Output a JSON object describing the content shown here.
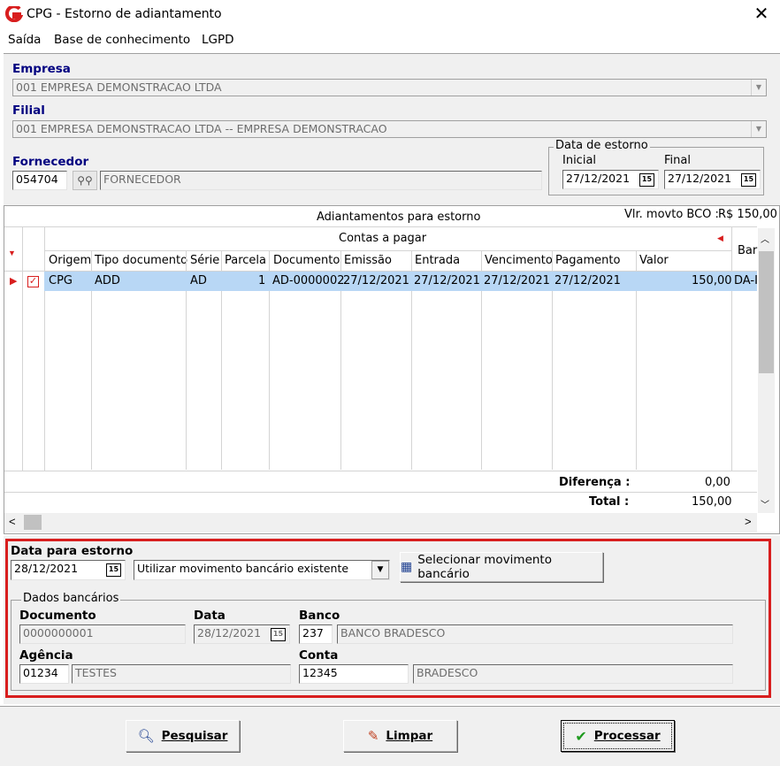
{
  "window": {
    "title": "CPG - Estorno de adiantamento",
    "close": "✕"
  },
  "menu": [
    "Saída",
    "Base de conhecimento",
    "LGPD"
  ],
  "empresa": {
    "label": "Empresa",
    "value": "001 EMPRESA DEMONSTRACAO LTDA"
  },
  "filial": {
    "label": "Filial",
    "value": "001 EMPRESA DEMONSTRACAO LTDA -- EMPRESA DEMONSTRACAO"
  },
  "fornecedor": {
    "label": "Fornecedor",
    "code": "054704",
    "name": "FORNECEDOR"
  },
  "data_estorno": {
    "group": "Data de estorno",
    "inicial_label": "Inicial",
    "inicial": "27/12/2021",
    "final_label": "Final",
    "final": "27/12/2021"
  },
  "grid": {
    "title": "Adiantamentos para estorno",
    "vlr_label": "Vlr. movto BCO :",
    "vlr_value": "R$ 150,00",
    "group_header": "Contas a pagar",
    "extra_header": "Bar",
    "columns": [
      "Origem",
      "Tipo documento",
      "Série",
      "Parcela",
      "Documento",
      "Emissão",
      "Entrada",
      "Vencimento",
      "Pagamento",
      "Valor"
    ],
    "row": {
      "origem": "CPG",
      "tipo": "ADD",
      "serie": "AD",
      "parcela": "1",
      "documento": "AD-0000002",
      "emissao": "27/12/2021",
      "entrada": "27/12/2021",
      "vencimento": "27/12/2021",
      "pagamento": "27/12/2021",
      "valor": "150,00",
      "banco": "DA-I"
    },
    "diferenca_label": "Diferença :",
    "diferenca_value": "0,00",
    "total_label": "Total :",
    "total_value": "150,00"
  },
  "estorno": {
    "label": "Data para estorno",
    "date": "28/12/2021",
    "option": "Utilizar movimento bancário existente",
    "select_button": "Selecionar movimento bancário"
  },
  "dados": {
    "group": "Dados bancários",
    "documento_label": "Documento",
    "documento": "0000000001",
    "data_label": "Data",
    "data": "28/12/2021",
    "banco_label": "Banco",
    "banco_code": "237",
    "banco_name": "BANCO BRADESCO",
    "agencia_label": "Agência",
    "agencia_code": "01234",
    "agencia_name": "TESTES",
    "conta_label": "Conta",
    "conta_code": "12345",
    "conta_name": "BRADESCO"
  },
  "footer": {
    "pesquisar": "Pesquisar",
    "limpar": "Limpar",
    "processar": "Processar"
  },
  "colors": {
    "accent_blue": "#000080",
    "highlight": "#b8d7f5",
    "red": "#d81e1e"
  }
}
